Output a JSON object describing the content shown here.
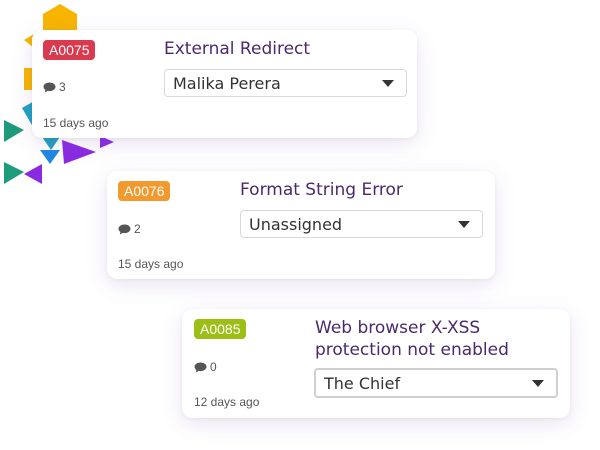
{
  "colors": {
    "badge_red": "#d93a4e",
    "badge_orange": "#f29a2e",
    "badge_green": "#9bbf14",
    "title_purple": "#4a2a6b"
  },
  "icons": {
    "comment": "comment-bubble-icon",
    "dropdown": "caret-down-icon"
  },
  "tickets": [
    {
      "id": "A0075",
      "title": "External Redirect",
      "comments": "3",
      "age": "15 days ago",
      "assignee": "Malika Perera"
    },
    {
      "id": "A0076",
      "title": "Format String Error",
      "comments": "2",
      "age": "15 days ago",
      "assignee": "Unassigned"
    },
    {
      "id": "A0085",
      "title": "Web browser X-XSS protection not enabled",
      "comments": "0",
      "age": "12 days ago",
      "assignee": "The Chief"
    }
  ]
}
